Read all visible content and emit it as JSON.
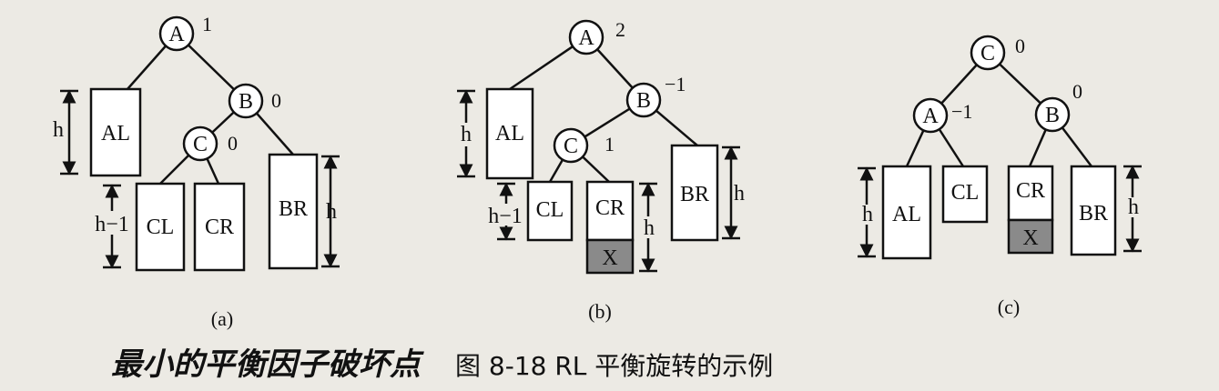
{
  "figure_title": "图 8-18   RL 平衡旋转的示例",
  "handwritten_note": "最小的平衡因子破坏点",
  "panels": [
    {
      "caption": "(a)",
      "nodes": [
        {
          "label": "A",
          "balance": "1"
        },
        {
          "label": "B",
          "balance": "0"
        },
        {
          "label": "C",
          "balance": "0"
        }
      ],
      "subtrees": [
        "AL",
        "CL",
        "CR",
        "BR"
      ],
      "heights": [
        "h",
        "h−1",
        "h"
      ]
    },
    {
      "caption": "(b)",
      "nodes": [
        {
          "label": "A",
          "balance": "2"
        },
        {
          "label": "B",
          "balance": "−1"
        },
        {
          "label": "C",
          "balance": "1"
        }
      ],
      "subtrees": [
        "AL",
        "CL",
        "CR",
        "BR"
      ],
      "inserted": "X",
      "heights": [
        "h",
        "h−1",
        "h",
        "h"
      ]
    },
    {
      "caption": "(c)",
      "nodes": [
        {
          "label": "C",
          "balance": "0"
        },
        {
          "label": "A",
          "balance": "−1"
        },
        {
          "label": "B",
          "balance": "0"
        }
      ],
      "subtrees": [
        "AL",
        "CL",
        "CR",
        "BR"
      ],
      "inserted": "X",
      "heights": [
        "h",
        "h"
      ]
    }
  ]
}
